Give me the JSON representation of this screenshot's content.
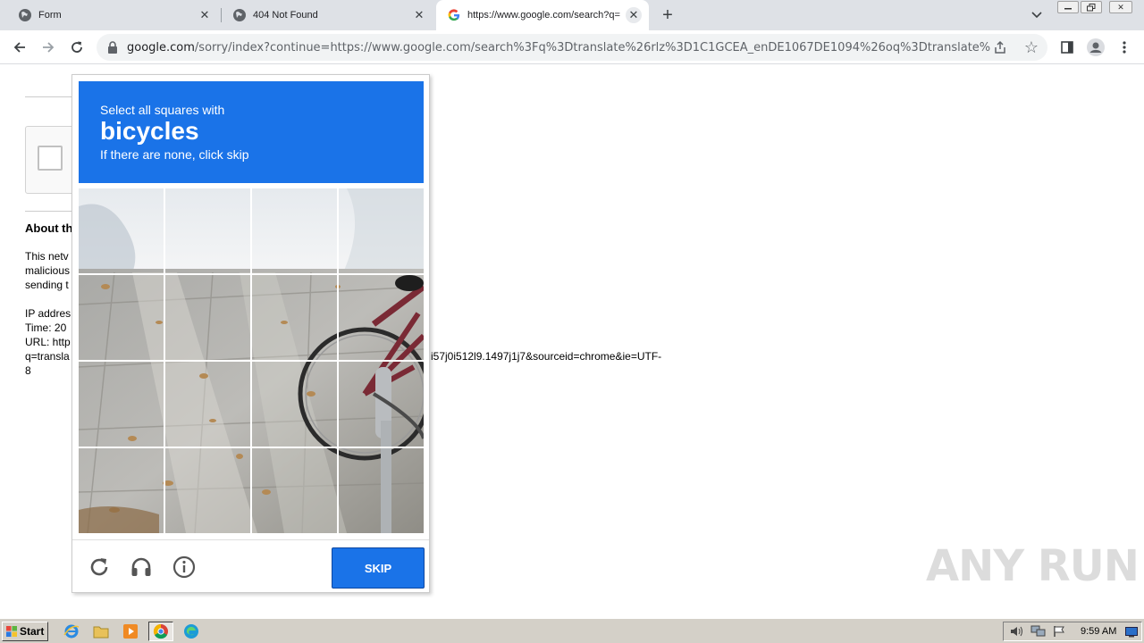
{
  "browser": {
    "tabs": [
      {
        "title": "Form",
        "icon": "globe-icon"
      },
      {
        "title": "404 Not Found",
        "icon": "globe-icon"
      },
      {
        "title": "https://www.google.com/search?q=",
        "icon": "google-icon"
      }
    ],
    "new_tab_label": "+",
    "url_host": "google.com",
    "url_rest": "/sorry/index?continue=https://www.google.com/search%3Fq%3Dtranslate%26rlz%3D1C1GCEA_enDE1067DE1094%26oq%3Dtranslate%2..."
  },
  "page": {
    "about_heading": "About th",
    "para_lines": [
      "This netv",
      "malicious",
      "sending t"
    ],
    "ip_line": "IP addres",
    "time_line": "Time: 20",
    "url_line": "URL: http",
    "q_line": "q=transla",
    "q_line_tail": "i57j0i512l9.1497j1j7&sourceid=chrome&ie=UTF-",
    "last_line": "8"
  },
  "captcha": {
    "line1": "Select all squares with",
    "target": "bicycles",
    "line3": "If there are none, click skip",
    "skip_label": "SKIP",
    "colors": {
      "header": "#1a73e8",
      "button": "#1a73e8"
    }
  },
  "watermark": "ANY RUN",
  "taskbar": {
    "start_label": "Start",
    "clock": "9:59 AM"
  }
}
